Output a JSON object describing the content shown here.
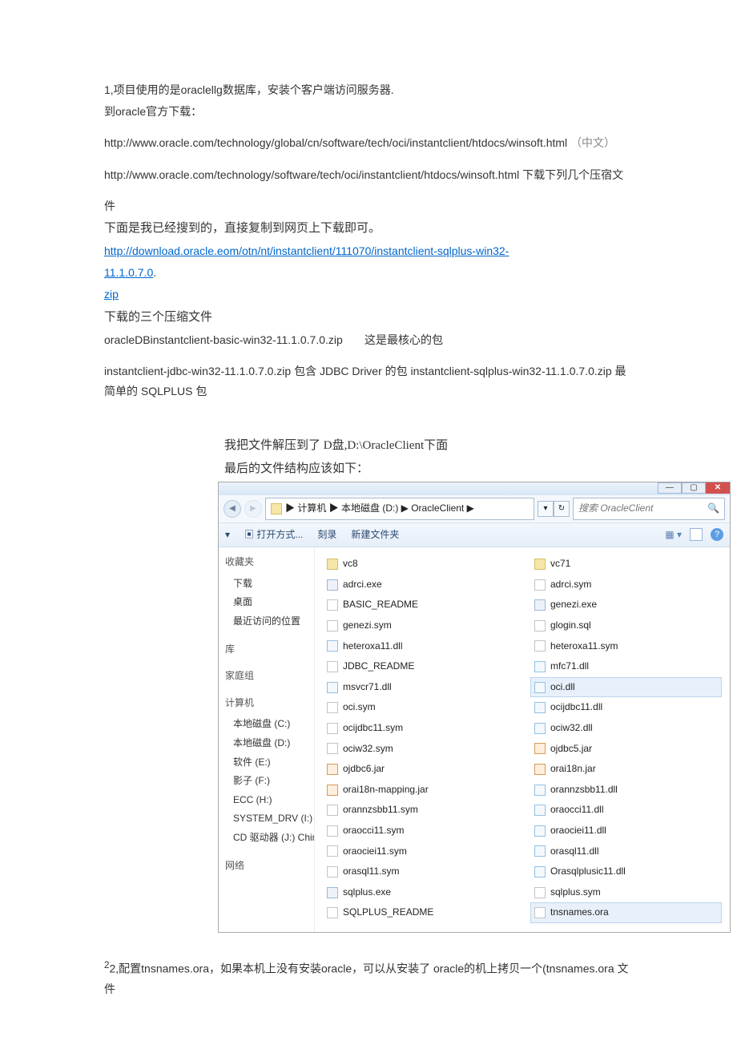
{
  "doc": {
    "line1": "1,项目使用的是oraclellg数据库，安装个客户端访问服务器.",
    "line2": "到oracle官方下载：",
    "url1": "http://www.oracle.com/technology/global/cn/software/tech/oci/instantclient/htdocs/winsoft.html",
    "url1_paren": "（中文）",
    "url2": "http://www.oracle.com/technology/software/tech/oci/instantclient/htdocs/winsoft.html",
    "url2_tail": " 下载下列几个压宿文",
    "line_jian": "件",
    "line3": "下面是我已经搜到的，直接复制到网页上下载即可。",
    "link_full_a": "http://download.oracle.eom/otn/nt/instantclient/111070/instantclient-sqlplus-win32-",
    "link_full_b": "11.1.0.7.0",
    "link_full_dot": ".",
    "zip": "zip",
    "threezip": "下载的三个压缩文件",
    "pkg_line": "oracleDBinstantclient-basic-win32-11.1.0.7.0.zip",
    "pkg_note": "这是最核心的包",
    "pkg2": "instantclient-jdbc-win32-11.1.0.7.0.zip 包含 JDBC Driver 的包 instantclient-sqlplus-win32-11.1.0.7.0.zip 最简单的 SQLPLUS 包",
    "extract1": "我把文件解压到了 D盘,D:\\OracleClient下面",
    "extract2": "最后的文件结构应该如下：",
    "footer": "2,配置tnsnames.ora，如果本机上没有安装oracle，可以从安装了 oracle的机上拷贝一个(tnsnames.ora 文件"
  },
  "explorer": {
    "path": "▶ 计算机 ▶ 本地磁盘 (D:) ▶ OracleClient ▶",
    "search_placeholder": "搜索 OracleClient",
    "toolbar": {
      "open": "打开方式...",
      "burn": "刻录",
      "newfolder": "新建文件夹"
    },
    "sidebar": {
      "fav": "收藏夹",
      "downloads": "下载",
      "desktop": "桌面",
      "recent": "最近访问的位置",
      "lib": "库",
      "home": "家庭组",
      "computer": "计算机",
      "c": "本地磁盘 (C:)",
      "d": "本地磁盘 (D:)",
      "e": "软件 (E:)",
      "f": "影子 (F:)",
      "h": "ECC (H:)",
      "i": "SYSTEM_DRV (I:)",
      "j": "CD 驱动器 (J:) Chin",
      "net": "网络"
    },
    "col1": [
      {
        "n": "vc8",
        "t": "folder"
      },
      {
        "n": "adrci.exe",
        "t": "exe"
      },
      {
        "n": "BASIC_README",
        "t": "file"
      },
      {
        "n": "genezi.sym",
        "t": "file"
      },
      {
        "n": "heteroxa11.dll",
        "t": "dll"
      },
      {
        "n": "JDBC_README",
        "t": "file"
      },
      {
        "n": "msvcr71.dll",
        "t": "dll"
      },
      {
        "n": "oci.sym",
        "t": "file"
      },
      {
        "n": "ocijdbc11.sym",
        "t": "file"
      },
      {
        "n": "ociw32.sym",
        "t": "file"
      },
      {
        "n": "ojdbc6.jar",
        "t": "jar"
      },
      {
        "n": "orai18n-mapping.jar",
        "t": "jar"
      },
      {
        "n": "orannzsbb11.sym",
        "t": "file"
      },
      {
        "n": "oraocci11.sym",
        "t": "file"
      },
      {
        "n": "oraociei11.sym",
        "t": "file"
      },
      {
        "n": "orasql11.sym",
        "t": "file"
      },
      {
        "n": "sqlplus.exe",
        "t": "exe"
      },
      {
        "n": "SQLPLUS_README",
        "t": "file"
      }
    ],
    "col2": [
      {
        "n": "vc71",
        "t": "folder"
      },
      {
        "n": "adrci.sym",
        "t": "file"
      },
      {
        "n": "genezi.exe",
        "t": "exe"
      },
      {
        "n": "glogin.sql",
        "t": "file"
      },
      {
        "n": "heteroxa11.sym",
        "t": "file"
      },
      {
        "n": "mfc71.dll",
        "t": "dll"
      },
      {
        "n": "oci.dll",
        "t": "dll",
        "sel": true
      },
      {
        "n": "ocijdbc11.dll",
        "t": "dll"
      },
      {
        "n": "ociw32.dll",
        "t": "dll"
      },
      {
        "n": "ojdbc5.jar",
        "t": "jar"
      },
      {
        "n": "orai18n.jar",
        "t": "jar"
      },
      {
        "n": "orannzsbb11.dll",
        "t": "dll"
      },
      {
        "n": "oraocci11.dll",
        "t": "dll"
      },
      {
        "n": "oraociei11.dll",
        "t": "dll"
      },
      {
        "n": "orasql11.dll",
        "t": "dll"
      },
      {
        "n": "Orasqlplusic11.dll",
        "t": "dll"
      },
      {
        "n": "sqlplus.sym",
        "t": "file"
      },
      {
        "n": "tnsnames.ora",
        "t": "file",
        "sel": true
      }
    ]
  }
}
